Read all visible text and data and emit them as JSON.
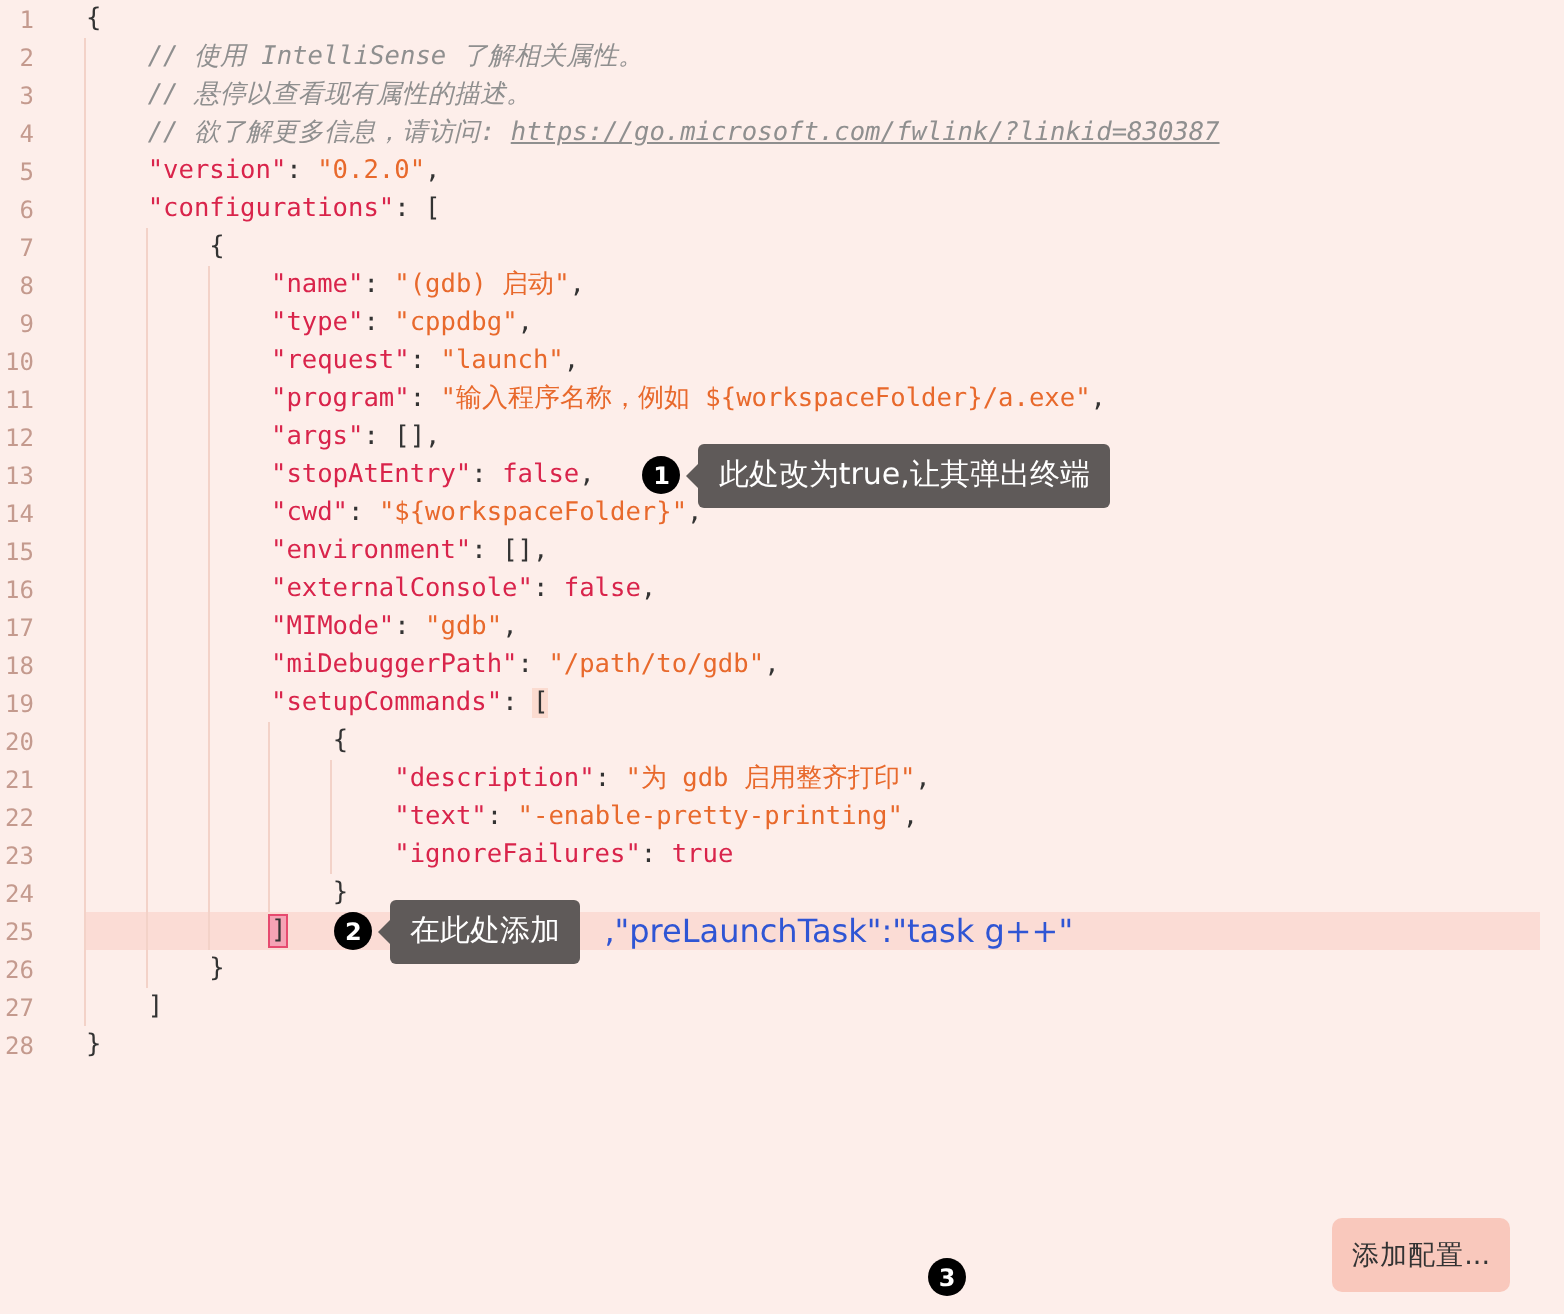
{
  "editor": {
    "lines": [
      {
        "number": "1",
        "current": false,
        "tokens": [
          {
            "kind": "punct",
            "text": "{"
          }
        ]
      },
      {
        "number": "2",
        "current": false,
        "tokens": [
          {
            "kind": "comment",
            "text": "    // 使用 IntelliSense 了解相关属性。"
          }
        ]
      },
      {
        "number": "3",
        "current": false,
        "tokens": [
          {
            "kind": "comment",
            "text": "    // 悬停以查看现有属性的描述。"
          }
        ]
      },
      {
        "number": "4",
        "current": false,
        "tokens": [
          {
            "kind": "comment",
            "text": "    // 欲了解更多信息，请访问: "
          },
          {
            "kind": "link",
            "text": "https://go.microsoft.com/fwlink/?linkid=830387"
          }
        ]
      },
      {
        "number": "5",
        "current": false,
        "tokens": [
          {
            "kind": "key",
            "text": "    \"version\""
          },
          {
            "kind": "punct",
            "text": ": "
          },
          {
            "kind": "string",
            "text": "\"0.2.0\""
          },
          {
            "kind": "punct",
            "text": ","
          }
        ]
      },
      {
        "number": "6",
        "current": false,
        "tokens": [
          {
            "kind": "key",
            "text": "    \"configurations\""
          },
          {
            "kind": "punct",
            "text": ": ["
          }
        ]
      },
      {
        "number": "7",
        "current": false,
        "tokens": [
          {
            "kind": "punct",
            "text": "        {"
          }
        ]
      },
      {
        "number": "8",
        "current": false,
        "tokens": [
          {
            "kind": "key",
            "text": "            \"name\""
          },
          {
            "kind": "punct",
            "text": ": "
          },
          {
            "kind": "string",
            "text": "\"(gdb) 启动\""
          },
          {
            "kind": "punct",
            "text": ","
          }
        ]
      },
      {
        "number": "9",
        "current": false,
        "tokens": [
          {
            "kind": "key",
            "text": "            \"type\""
          },
          {
            "kind": "punct",
            "text": ": "
          },
          {
            "kind": "string",
            "text": "\"cppdbg\""
          },
          {
            "kind": "punct",
            "text": ","
          }
        ]
      },
      {
        "number": "10",
        "current": false,
        "tokens": [
          {
            "kind": "key",
            "text": "            \"request\""
          },
          {
            "kind": "punct",
            "text": ": "
          },
          {
            "kind": "string",
            "text": "\"launch\""
          },
          {
            "kind": "punct",
            "text": ","
          }
        ]
      },
      {
        "number": "11",
        "current": false,
        "tokens": [
          {
            "kind": "key",
            "text": "            \"program\""
          },
          {
            "kind": "punct",
            "text": ": "
          },
          {
            "kind": "string",
            "text": "\"输入程序名称，例如 ${workspaceFolder}/a.exe\""
          },
          {
            "kind": "punct",
            "text": ","
          }
        ]
      },
      {
        "number": "12",
        "current": false,
        "tokens": [
          {
            "kind": "key",
            "text": "            \"args\""
          },
          {
            "kind": "punct",
            "text": ": [],"
          }
        ]
      },
      {
        "number": "13",
        "current": false,
        "tokens": [
          {
            "kind": "key",
            "text": "            \"stopAtEntry\""
          },
          {
            "kind": "punct",
            "text": ": "
          },
          {
            "kind": "keyword",
            "text": "false"
          },
          {
            "kind": "punct",
            "text": ","
          }
        ],
        "annotations": [
          {
            "kind": "badge",
            "text": "1"
          },
          {
            "kind": "tooltip",
            "text": "此处改为true,让其弹出终端"
          }
        ]
      },
      {
        "number": "14",
        "current": false,
        "tokens": [
          {
            "kind": "key",
            "text": "            \"cwd\""
          },
          {
            "kind": "punct",
            "text": ": "
          },
          {
            "kind": "string",
            "text": "\"${workspaceFolder}\""
          },
          {
            "kind": "punct",
            "text": ","
          }
        ]
      },
      {
        "number": "15",
        "current": false,
        "tokens": [
          {
            "kind": "key",
            "text": "            \"environment\""
          },
          {
            "kind": "punct",
            "text": ": [],"
          }
        ]
      },
      {
        "number": "16",
        "current": false,
        "tokens": [
          {
            "kind": "key",
            "text": "            \"externalConsole\""
          },
          {
            "kind": "punct",
            "text": ": "
          },
          {
            "kind": "keyword",
            "text": "false"
          },
          {
            "kind": "punct",
            "text": ","
          }
        ]
      },
      {
        "number": "17",
        "current": false,
        "tokens": [
          {
            "kind": "key",
            "text": "            \"MIMode\""
          },
          {
            "kind": "punct",
            "text": ": "
          },
          {
            "kind": "string",
            "text": "\"gdb\""
          },
          {
            "kind": "punct",
            "text": ","
          }
        ]
      },
      {
        "number": "18",
        "current": false,
        "tokens": [
          {
            "kind": "key",
            "text": "            \"miDebuggerPath\""
          },
          {
            "kind": "punct",
            "text": ": "
          },
          {
            "kind": "string",
            "text": "\"/path/to/gdb\""
          },
          {
            "kind": "punct",
            "text": ","
          }
        ]
      },
      {
        "number": "19",
        "current": false,
        "tokens": [
          {
            "kind": "key",
            "text": "            \"setupCommands\""
          },
          {
            "kind": "punct",
            "text": ": "
          },
          {
            "kind": "punct",
            "text": "[",
            "matched": true
          }
        ]
      },
      {
        "number": "20",
        "current": false,
        "tokens": [
          {
            "kind": "punct",
            "text": "                {"
          }
        ]
      },
      {
        "number": "21",
        "current": false,
        "tokens": [
          {
            "kind": "key",
            "text": "                    \"description\""
          },
          {
            "kind": "punct",
            "text": ": "
          },
          {
            "kind": "string",
            "text": "\"为 gdb 启用整齐打印\""
          },
          {
            "kind": "punct",
            "text": ","
          }
        ]
      },
      {
        "number": "22",
        "current": false,
        "tokens": [
          {
            "kind": "key",
            "text": "                    \"text\""
          },
          {
            "kind": "punct",
            "text": ": "
          },
          {
            "kind": "string",
            "text": "\"-enable-pretty-printing\""
          },
          {
            "kind": "punct",
            "text": ","
          }
        ]
      },
      {
        "number": "23",
        "current": false,
        "tokens": [
          {
            "kind": "key",
            "text": "                    \"ignoreFailures\""
          },
          {
            "kind": "punct",
            "text": ": "
          },
          {
            "kind": "keyword",
            "text": "true"
          }
        ]
      },
      {
        "number": "24",
        "current": false,
        "tokens": [
          {
            "kind": "punct",
            "text": "                }"
          }
        ]
      },
      {
        "number": "25",
        "current": true,
        "tokens": [
          {
            "kind": "punct",
            "text": "            ]",
            "matched": true
          }
        ],
        "annotations": [
          {
            "kind": "badge",
            "text": "2"
          },
          {
            "kind": "tooltip",
            "text": "在此处添加"
          },
          {
            "kind": "note",
            "text": ",\"preLaunchTask\":\"task g++\""
          }
        ]
      },
      {
        "number": "26",
        "current": false,
        "tokens": [
          {
            "kind": "punct",
            "text": "        }"
          }
        ]
      },
      {
        "number": "27",
        "current": false,
        "tokens": [
          {
            "kind": "punct",
            "text": "    ]"
          }
        ]
      },
      {
        "number": "28",
        "current": false,
        "tokens": [
          {
            "kind": "punct",
            "text": "}"
          }
        ]
      }
    ]
  },
  "footer": {
    "badge": "3",
    "add_button": "添加配置..."
  }
}
